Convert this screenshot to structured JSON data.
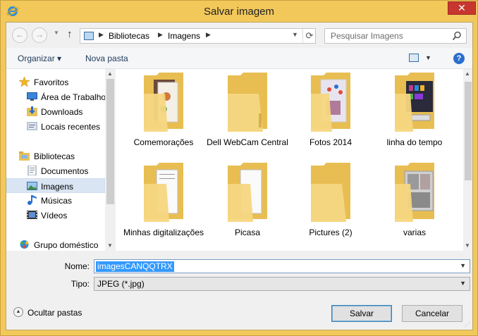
{
  "window": {
    "title": "Salvar imagem",
    "close_label": "✕"
  },
  "nav": {
    "back_icon": "←",
    "forward_icon": "→",
    "up_icon": "↑",
    "path": [
      "Bibliotecas",
      "Imagens"
    ],
    "search_placeholder": "Pesquisar Imagens"
  },
  "toolbar": {
    "organize_label": "Organizar ▾",
    "new_folder_label": "Nova pasta",
    "help_label": "?"
  },
  "sidebar": {
    "items": [
      {
        "label": "Favoritos",
        "icon": "star-icon"
      },
      {
        "label": "Área de Trabalho",
        "icon": "desktop-icon"
      },
      {
        "label": "Downloads",
        "icon": "downloads-icon"
      },
      {
        "label": "Locais recentes",
        "icon": "recent-places-icon"
      },
      {
        "label": "Bibliotecas",
        "icon": "libraries-icon"
      },
      {
        "label": "Documentos",
        "icon": "documents-icon"
      },
      {
        "label": "Imagens",
        "icon": "pictures-icon",
        "selected": true
      },
      {
        "label": "Músicas",
        "icon": "music-icon"
      },
      {
        "label": "Vídeos",
        "icon": "videos-icon"
      },
      {
        "label": "Grupo doméstico",
        "icon": "homegroup-icon"
      }
    ]
  },
  "folders": [
    {
      "label": "Comemorações"
    },
    {
      "label": "Dell WebCam Central"
    },
    {
      "label": "Fotos 2014"
    },
    {
      "label": "linha do tempo"
    },
    {
      "label": "Minhas digitalizações"
    },
    {
      "label": "Picasa"
    },
    {
      "label": "Pictures (2)"
    },
    {
      "label": "varias"
    }
  ],
  "form": {
    "name_label": "Nome:",
    "name_value": "imagesCANQQTRX",
    "type_label": "Tipo:",
    "type_value": "JPEG (*.jpg)"
  },
  "footer": {
    "hide_folders_label": "Ocultar pastas",
    "save_label": "Salvar",
    "cancel_label": "Cancelar"
  },
  "colors": {
    "frame": "#f2c85a",
    "selection": "#3399ff",
    "close": "#c7372f",
    "folder": "#f3d27a"
  }
}
